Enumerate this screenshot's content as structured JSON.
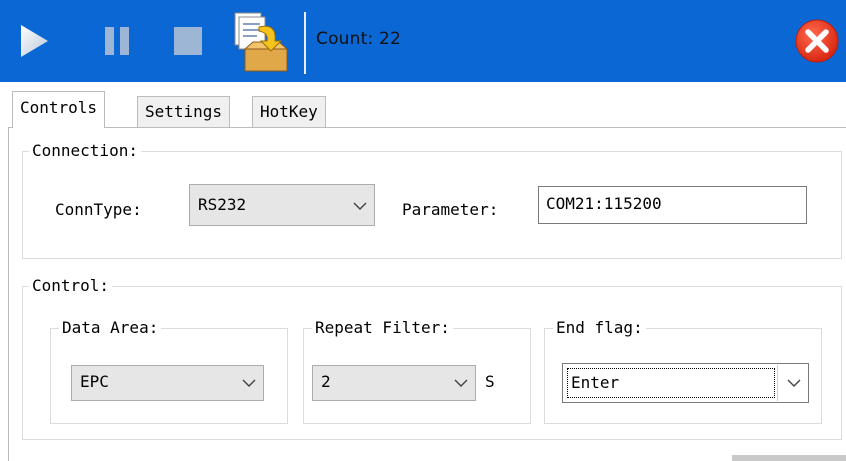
{
  "toolbar": {
    "count_label": "Count:",
    "count_value": "22",
    "icons": [
      "play-icon",
      "pause-icon",
      "stop-icon",
      "export-icon",
      "close-icon"
    ],
    "colors": {
      "background": "#0a67d3",
      "close": "#e8341c"
    }
  },
  "tabs": [
    {
      "label": "Controls",
      "active": true
    },
    {
      "label": "Settings",
      "active": false
    },
    {
      "label": "HotKey",
      "active": false
    }
  ],
  "connection": {
    "legend": "Connection:",
    "conn_type_label": "ConnType:",
    "conn_type_value": "RS232",
    "parameter_label": "Parameter:",
    "parameter_value": "COM21:115200"
  },
  "control": {
    "legend": "Control:",
    "data_area": {
      "legend": "Data Area:",
      "value": "EPC"
    },
    "repeat_filter": {
      "legend": "Repeat Filter:",
      "value": "2",
      "unit": "S"
    },
    "end_flag": {
      "legend": "End flag:",
      "value": "Enter"
    }
  }
}
